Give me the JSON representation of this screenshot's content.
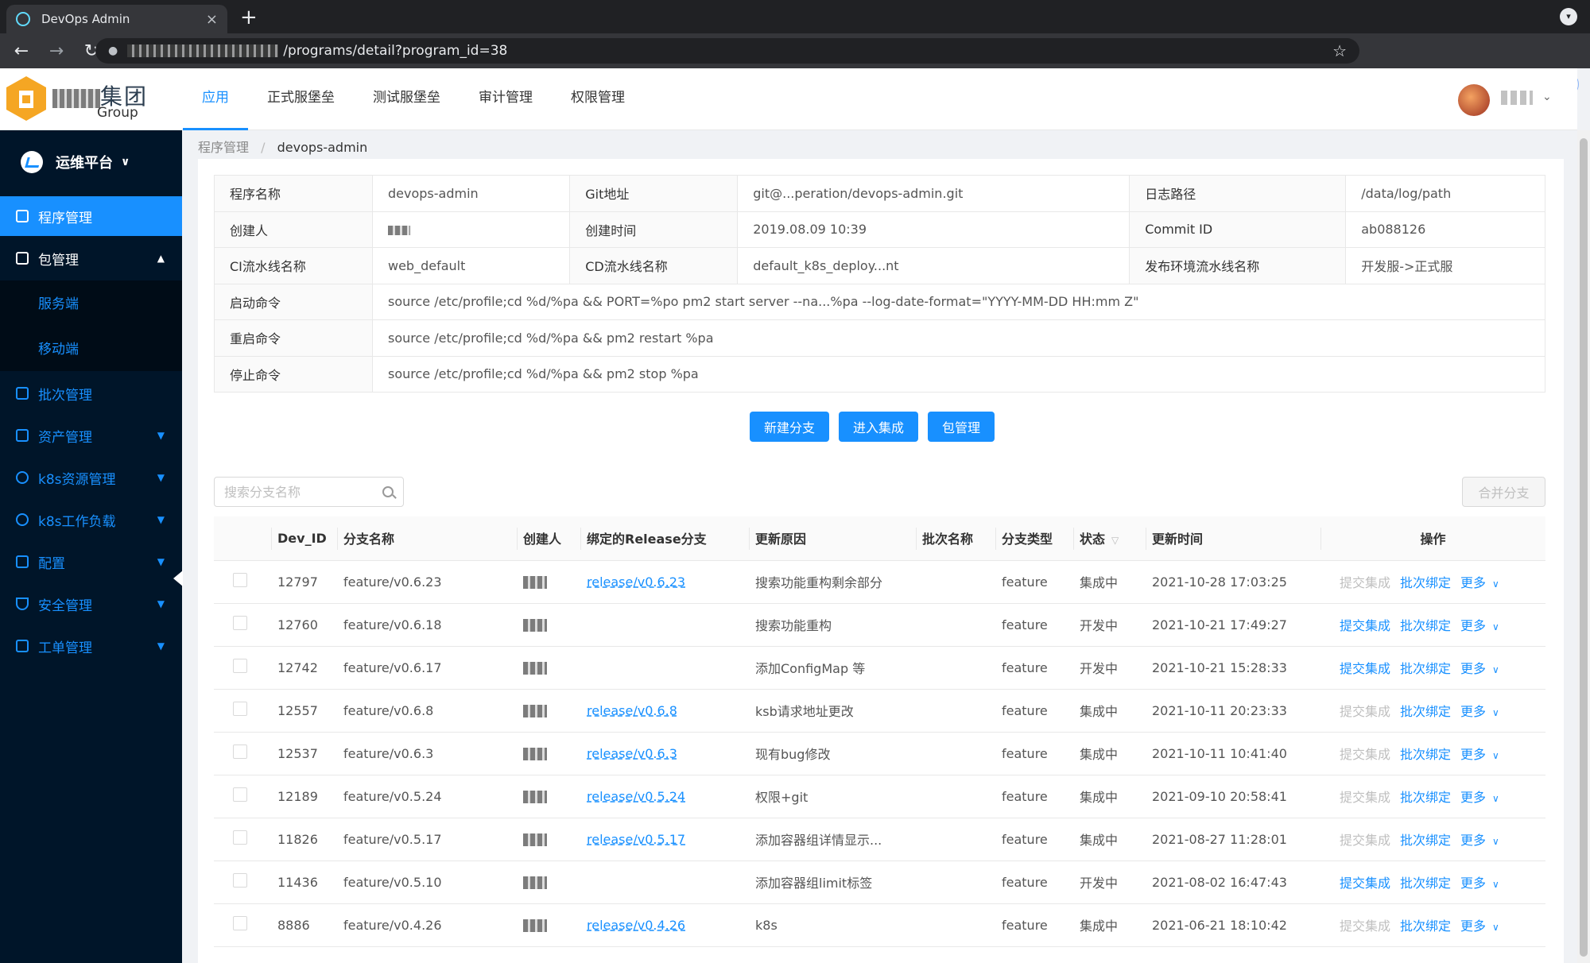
{
  "browser": {
    "tab_title": "DevOps Admin",
    "tab_close": "×",
    "new_tab": "+",
    "url": "/programs/detail?program_id=38",
    "update_label": "更新"
  },
  "header": {
    "logo_text": "集团",
    "logo_sub": "Group",
    "nav": [
      "应用",
      "正式服堡垒",
      "测试服堡垒",
      "审计管理",
      "权限管理"
    ]
  },
  "sidebar": {
    "brand": "运维平台",
    "items": [
      {
        "label": "程序管理"
      },
      {
        "label": "包管理"
      },
      {
        "label": "服务端"
      },
      {
        "label": "移动端"
      },
      {
        "label": "批次管理"
      },
      {
        "label": "资产管理"
      },
      {
        "label": "k8s资源管理"
      },
      {
        "label": "k8s工作负载"
      },
      {
        "label": "配置"
      },
      {
        "label": "安全管理"
      },
      {
        "label": "工单管理"
      }
    ]
  },
  "breadcrumb": {
    "parent": "程序管理",
    "separator": "/",
    "current": "devops-admin"
  },
  "info": {
    "program_name_label": "程序名称",
    "program_name": "devops-admin",
    "git_label": "Git地址",
    "git": "git@...peration/devops-admin.git",
    "log_label": "日志路径",
    "log": "/data/log/path",
    "creator_label": "创建人",
    "created_label": "创建时间",
    "created": "2019.08.09 10:39",
    "commit_label": "Commit ID",
    "commit": "ab088126",
    "ci_label": "CI流水线名称",
    "ci": "web_default",
    "cd_label": "CD流水线名称",
    "cd": "default_k8s_deploy...nt",
    "release_label": "发布环境流水线名称",
    "release": "开发服->正式服",
    "start_label": "启动命令",
    "start": "source /etc/profile;cd %d/%pa && PORT=%po pm2 start server --na...%pa --log-date-format=\"YYYY-MM-DD HH:mm Z\"",
    "restart_label": "重启命令",
    "restart": "source /etc/profile;cd %d/%pa && pm2 restart %pa",
    "stop_label": "停止命令",
    "stop": "source /etc/profile;cd %d/%pa && pm2 stop %pa"
  },
  "buttons": {
    "new_branch": "新建分支",
    "enter_integration": "进入集成",
    "package_mgmt": "包管理",
    "merge_branch": "合并分支"
  },
  "search": {
    "placeholder": "搜索分支名称"
  },
  "table": {
    "headers": [
      "Dev_ID",
      "分支名称",
      "创建人",
      "绑定的Release分支",
      "更新原因",
      "批次名称",
      "分支类型",
      "状态",
      "更新时间",
      "操作"
    ],
    "actions": {
      "submit": "提交集成",
      "bind": "批次绑定",
      "more": "更多"
    },
    "rows": [
      {
        "id": "12797",
        "branch": "feature/v0.6.23",
        "release": "release/v0.6.23",
        "reason": "搜索功能重构剩余部分",
        "type": "feature",
        "status": "集成中",
        "time": "2021-10-28 17:03:25"
      },
      {
        "id": "12760",
        "branch": "feature/v0.6.18",
        "release": "",
        "reason": "搜索功能重构",
        "type": "feature",
        "status": "开发中",
        "time": "2021-10-21 17:49:27"
      },
      {
        "id": "12742",
        "branch": "feature/v0.6.17",
        "release": "",
        "reason": "添加ConfigMap 等",
        "type": "feature",
        "status": "开发中",
        "time": "2021-10-21 15:28:33"
      },
      {
        "id": "12557",
        "branch": "feature/v0.6.8",
        "release": "release/v0.6.8",
        "reason": "ksb请求地址更改",
        "type": "feature",
        "status": "集成中",
        "time": "2021-10-11 20:23:33"
      },
      {
        "id": "12537",
        "branch": "feature/v0.6.3",
        "release": "release/v0.6.3",
        "reason": "现有bug修改",
        "type": "feature",
        "status": "集成中",
        "time": "2021-10-11 10:41:40"
      },
      {
        "id": "12189",
        "branch": "feature/v0.5.24",
        "release": "release/v0.5.24",
        "reason": "权限+git",
        "type": "feature",
        "status": "集成中",
        "time": "2021-09-10 20:58:41"
      },
      {
        "id": "11826",
        "branch": "feature/v0.5.17",
        "release": "release/v0.5.17",
        "reason": "添加容器组详情显示...",
        "type": "feature",
        "status": "集成中",
        "time": "2021-08-27 11:28:01"
      },
      {
        "id": "11436",
        "branch": "feature/v0.5.10",
        "release": "",
        "reason": "添加容器组limit标签",
        "type": "feature",
        "status": "开发中",
        "time": "2021-08-02 16:47:43"
      },
      {
        "id": "8886",
        "branch": "feature/v0.4.26",
        "release": "release/v0.4.26",
        "reason": "k8s",
        "type": "feature",
        "status": "集成中",
        "time": "2021-06-21 18:10:42"
      }
    ]
  }
}
